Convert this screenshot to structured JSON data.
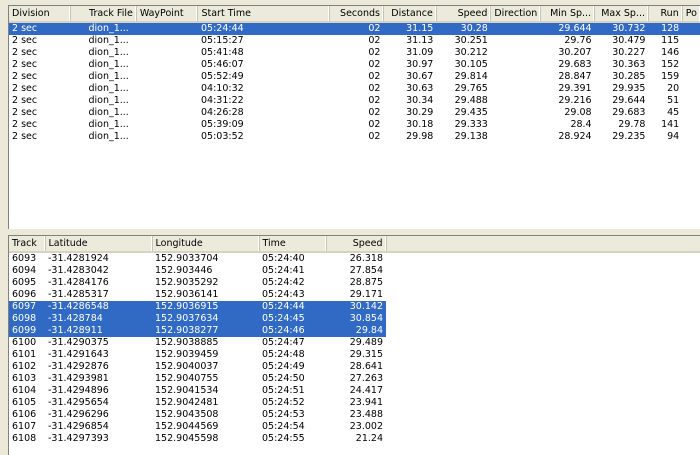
{
  "division_table": {
    "columns": [
      "Division",
      "Track File",
      "WayPoint",
      "Start Time",
      "Seconds",
      "Distance",
      "Speed",
      "Direction",
      "Min Sp...",
      "Max Sp...",
      "Run",
      "Po"
    ],
    "rows": [
      {
        "selected": true,
        "cells": [
          "2 sec",
          "dion_1...",
          "",
          "05:24:44",
          "02",
          "31.15",
          "30.28",
          "",
          "29.644",
          "30.732",
          "128",
          ""
        ]
      },
      {
        "selected": false,
        "cells": [
          "2 sec",
          "dion_1...",
          "",
          "05:15:27",
          "02",
          "31.13",
          "30.251",
          "",
          "29.76",
          "30.479",
          "115",
          ""
        ]
      },
      {
        "selected": false,
        "cells": [
          "2 sec",
          "dion_1...",
          "",
          "05:41:48",
          "02",
          "31.09",
          "30.212",
          "",
          "30.207",
          "30.227",
          "146",
          ""
        ]
      },
      {
        "selected": false,
        "cells": [
          "2 sec",
          "dion_1...",
          "",
          "05:46:07",
          "02",
          "30.97",
          "30.105",
          "",
          "29.683",
          "30.363",
          "152",
          ""
        ]
      },
      {
        "selected": false,
        "cells": [
          "2 sec",
          "dion_1...",
          "",
          "05:52:49",
          "02",
          "30.67",
          "29.814",
          "",
          "28.847",
          "30.285",
          "159",
          ""
        ]
      },
      {
        "selected": false,
        "cells": [
          "2 sec",
          "dion_1...",
          "",
          "04:10:32",
          "02",
          "30.63",
          "29.765",
          "",
          "29.391",
          "29.935",
          "20",
          ""
        ]
      },
      {
        "selected": false,
        "cells": [
          "2 sec",
          "dion_1...",
          "",
          "04:31:22",
          "02",
          "30.34",
          "29.488",
          "",
          "29.216",
          "29.644",
          "51",
          ""
        ]
      },
      {
        "selected": false,
        "cells": [
          "2 sec",
          "dion_1...",
          "",
          "04:26:28",
          "02",
          "30.29",
          "29.435",
          "",
          "29.08",
          "29.683",
          "45",
          ""
        ]
      },
      {
        "selected": false,
        "cells": [
          "2 sec",
          "dion_1...",
          "",
          "05:39:09",
          "02",
          "30.18",
          "29.333",
          "",
          "28.4",
          "29.78",
          "141",
          ""
        ]
      },
      {
        "selected": false,
        "cells": [
          "2 sec",
          "dion_1...",
          "",
          "05:03:52",
          "02",
          "29.98",
          "29.138",
          "",
          "28.924",
          "29.235",
          "94",
          ""
        ]
      }
    ]
  },
  "track_table": {
    "columns": [
      "Track",
      "Latitude",
      "Longitude",
      "Time",
      "Speed"
    ],
    "rows": [
      {
        "selected": false,
        "cells": [
          "6093",
          "-31.4281924",
          "152.9033704",
          "05:24:40",
          "26.318"
        ]
      },
      {
        "selected": false,
        "cells": [
          "6094",
          "-31.4283042",
          "152.903446",
          "05:24:41",
          "27.854"
        ]
      },
      {
        "selected": false,
        "cells": [
          "6095",
          "-31.4284176",
          "152.9035292",
          "05:24:42",
          "28.875"
        ]
      },
      {
        "selected": false,
        "cells": [
          "6096",
          "-31.4285317",
          "152.9036141",
          "05:24:43",
          "29.171"
        ]
      },
      {
        "selected": true,
        "cells": [
          "6097",
          "-31.4286548",
          "152.9036915",
          "05:24:44",
          "30.142"
        ]
      },
      {
        "selected": true,
        "cells": [
          "6098",
          "-31.428784",
          "152.9037634",
          "05:24:45",
          "30.854"
        ]
      },
      {
        "selected": true,
        "cells": [
          "6099",
          "-31.428911",
          "152.9038277",
          "05:24:46",
          "29.84"
        ]
      },
      {
        "selected": false,
        "cells": [
          "6100",
          "-31.4290375",
          "152.9038885",
          "05:24:47",
          "29.489"
        ]
      },
      {
        "selected": false,
        "cells": [
          "6101",
          "-31.4291643",
          "152.9039459",
          "05:24:48",
          "29.315"
        ]
      },
      {
        "selected": false,
        "cells": [
          "6102",
          "-31.4292876",
          "152.9040037",
          "05:24:49",
          "28.641"
        ]
      },
      {
        "selected": false,
        "cells": [
          "6103",
          "-31.4293981",
          "152.9040755",
          "05:24:50",
          "27.263"
        ]
      },
      {
        "selected": false,
        "cells": [
          "6104",
          "-31.4294896",
          "152.9041534",
          "05:24:51",
          "24.417"
        ]
      },
      {
        "selected": false,
        "cells": [
          "6105",
          "-31.4295654",
          "152.9042481",
          "05:24:52",
          "23.941"
        ]
      },
      {
        "selected": false,
        "cells": [
          "6106",
          "-31.4296296",
          "152.9043508",
          "05:24:53",
          "23.488"
        ]
      },
      {
        "selected": false,
        "cells": [
          "6107",
          "-31.4296854",
          "152.9044569",
          "05:24:54",
          "23.002"
        ]
      },
      {
        "selected": false,
        "cells": [
          "6108",
          "-31.4297393",
          "152.9045598",
          "05:24:55",
          "21.24"
        ]
      }
    ]
  },
  "colors": {
    "selection": "#316ac5",
    "header": "#ebeadb",
    "window": "#ece9d8"
  }
}
